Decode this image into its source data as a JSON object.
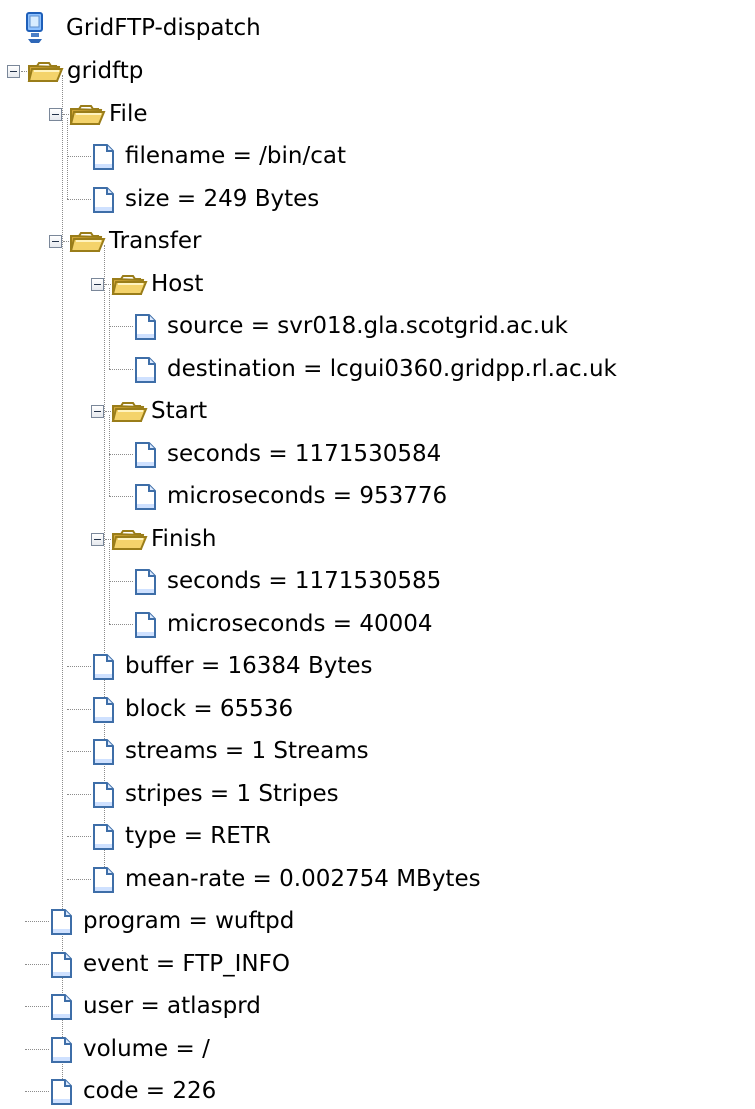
{
  "tree": {
    "root_label": "GridFTP-dispatch",
    "items": [
      {
        "depth": 0,
        "label": "gridftp",
        "kind": "folder",
        "expanded": true
      },
      {
        "depth": 1,
        "label": "File",
        "kind": "folder",
        "expanded": true
      },
      {
        "depth": 2,
        "label": "filename = /bin/cat",
        "kind": "leaf"
      },
      {
        "depth": 2,
        "label": "size = 249 Bytes",
        "kind": "leaf"
      },
      {
        "depth": 1,
        "label": "Transfer",
        "kind": "folder",
        "expanded": true
      },
      {
        "depth": 2,
        "label": "Host",
        "kind": "folder",
        "expanded": true
      },
      {
        "depth": 3,
        "label": "source = svr018.gla.scotgrid.ac.uk",
        "kind": "leaf"
      },
      {
        "depth": 3,
        "label": "destination = lcgui0360.gridpp.rl.ac.uk",
        "kind": "leaf"
      },
      {
        "depth": 2,
        "label": "Start",
        "kind": "folder",
        "expanded": true
      },
      {
        "depth": 3,
        "label": "seconds = 1171530584",
        "kind": "leaf"
      },
      {
        "depth": 3,
        "label": "microseconds = 953776",
        "kind": "leaf"
      },
      {
        "depth": 2,
        "label": "Finish",
        "kind": "folder",
        "expanded": true
      },
      {
        "depth": 3,
        "label": "seconds = 1171530585",
        "kind": "leaf"
      },
      {
        "depth": 3,
        "label": "microseconds = 40004",
        "kind": "leaf"
      },
      {
        "depth": 2,
        "label": "buffer = 16384 Bytes",
        "kind": "leaf"
      },
      {
        "depth": 2,
        "label": "block = 65536",
        "kind": "leaf"
      },
      {
        "depth": 2,
        "label": "streams = 1 Streams",
        "kind": "leaf"
      },
      {
        "depth": 2,
        "label": "stripes = 1 Stripes",
        "kind": "leaf"
      },
      {
        "depth": 2,
        "label": "type = RETR",
        "kind": "leaf"
      },
      {
        "depth": 2,
        "label": "mean-rate = 0.002754 MBytes",
        "kind": "leaf"
      },
      {
        "depth": 1,
        "label": "program = wuftpd",
        "kind": "leaf"
      },
      {
        "depth": 1,
        "label": "event = FTP_INFO",
        "kind": "leaf"
      },
      {
        "depth": 1,
        "label": "user = atlasprd",
        "kind": "leaf"
      },
      {
        "depth": 1,
        "label": "volume = /",
        "kind": "leaf"
      },
      {
        "depth": 1,
        "label": "code = 226",
        "kind": "leaf"
      }
    ]
  },
  "icons": {
    "root": "computer-icon",
    "folder": "folder-open-icon",
    "leaf": "document-icon",
    "toggle": "collapse-icon"
  },
  "colors": {
    "background": "#ffffff",
    "text": "#000000",
    "guide_lines": "#8c8c8c",
    "folder_fill": "#f4d36b",
    "folder_outline": "#9a7d19",
    "document_outline": "#3e6ea8",
    "document_fill": "#ffffff",
    "computer_blue": "#2f6fc8"
  }
}
